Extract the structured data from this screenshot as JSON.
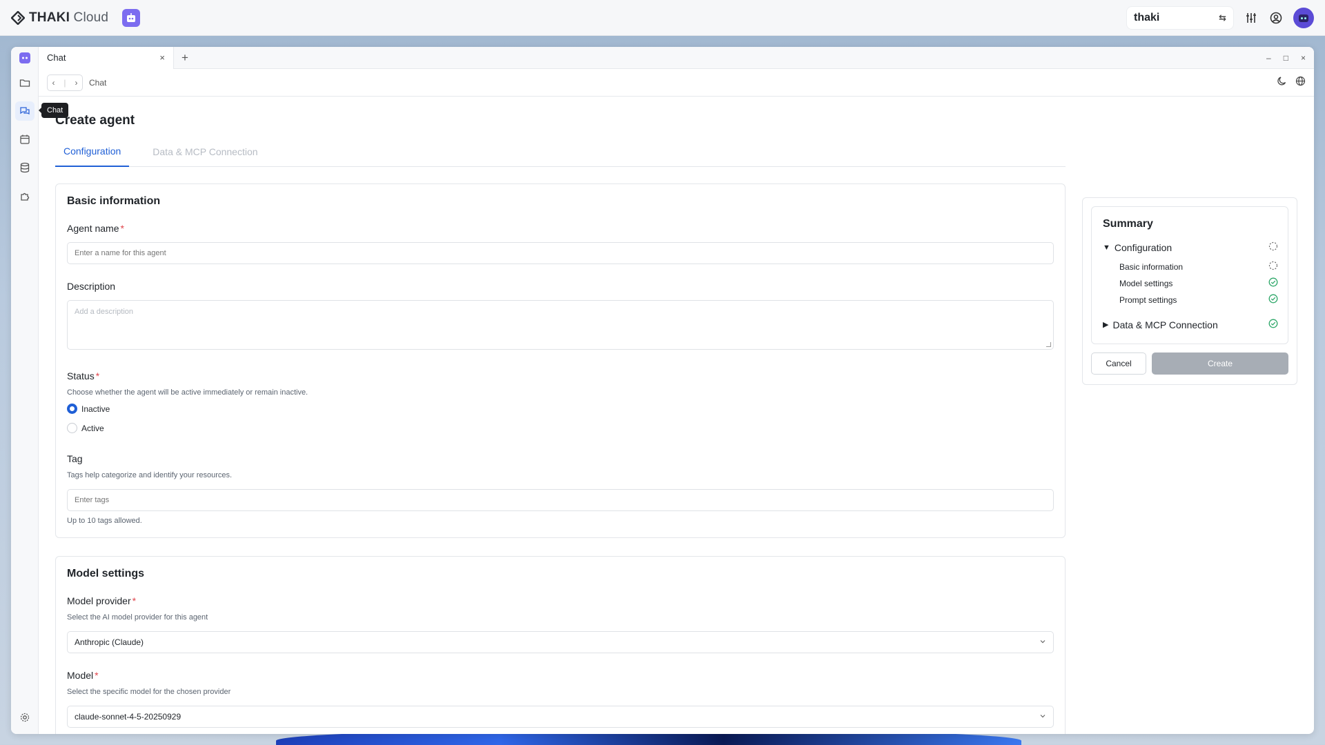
{
  "topbar": {
    "brand_bold": "THAKI",
    "brand_light": "Cloud",
    "workspace": "thaki"
  },
  "window": {
    "tab_label": "Chat",
    "tab_close": "×",
    "tab_add": "+",
    "controls": [
      "–",
      "□",
      "×"
    ]
  },
  "navbar": {
    "breadcrumb": "Chat"
  },
  "rail": {
    "tooltip": "Chat"
  },
  "page": {
    "title": "Create agent",
    "tabs": [
      "Configuration",
      "Data & MCP Connection"
    ]
  },
  "basic_info": {
    "title": "Basic information",
    "agent_name_label": "Agent name",
    "agent_name_placeholder": "Enter a name for this agent",
    "description_label": "Description",
    "description_placeholder": "Add a description",
    "status_label": "Status",
    "status_hint": "Choose whether the agent will be active immediately or remain inactive.",
    "status_options": [
      "Inactive",
      "Active"
    ],
    "status_selected": "Inactive",
    "tag_label": "Tag",
    "tag_hint": "Tags help categorize and identify your resources.",
    "tag_placeholder": "Enter tags",
    "tag_footer": "Up to 10 tags allowed."
  },
  "model_settings": {
    "title": "Model settings",
    "provider_label": "Model provider",
    "provider_hint": "Select the AI model provider for this agent",
    "provider_value": "Anthropic (Claude)",
    "model_label": "Model",
    "model_hint": "Select the specific model for the chosen provider",
    "model_value": "claude-sonnet-4-5-20250929"
  },
  "summary": {
    "title": "Summary",
    "configuration": "Configuration",
    "items": [
      "Basic information",
      "Model settings",
      "Prompt settings"
    ],
    "data_mcp": "Data & MCP Connection",
    "cancel": "Cancel",
    "create": "Create"
  },
  "colors": {
    "accent": "#1f5fd6",
    "success": "#2fa86a",
    "required": "#e0444b",
    "disabled_button": "#a7adb5"
  }
}
